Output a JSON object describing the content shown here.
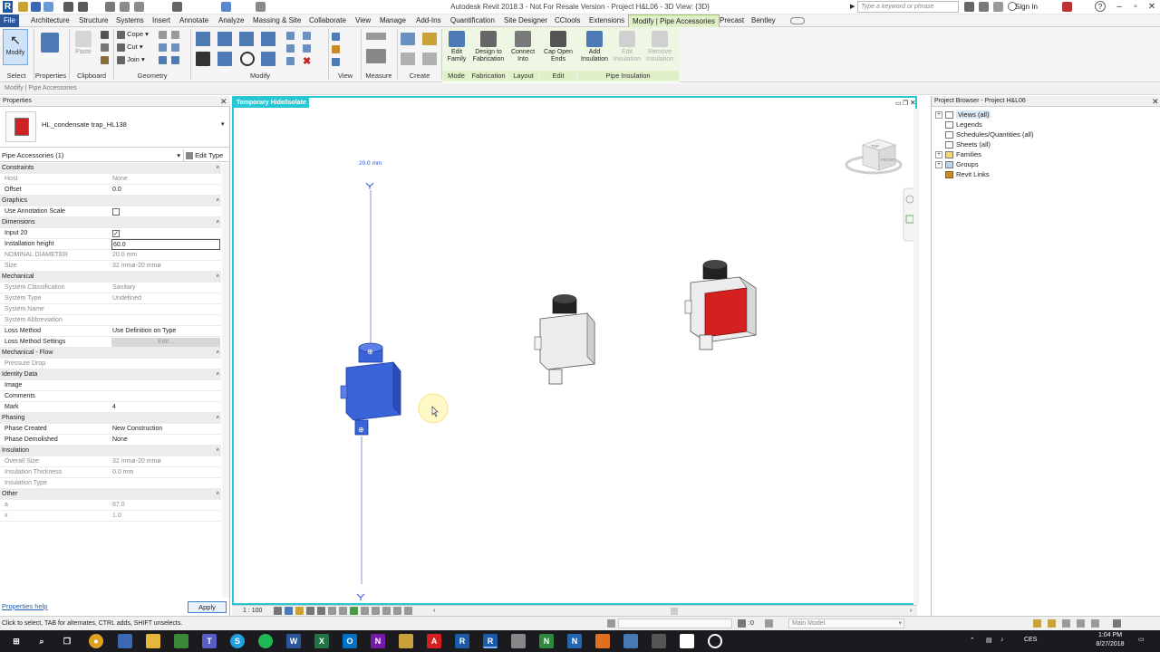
{
  "app": {
    "title": "Autodesk Revit 2018.3 - Not For Resale Version -   Project H&L06 - 3D View: {3D}",
    "search_placeholder": "Type a keyword or phrase",
    "sign_in": "Sign In",
    "help": "?"
  },
  "ribbon_tabs": [
    "File",
    "Architecture",
    "Structure",
    "Systems",
    "Insert",
    "Annotate",
    "Analyze",
    "Massing & Site",
    "Collaborate",
    "View",
    "Manage",
    "Add-Ins",
    "Quantification",
    "Site Designer",
    "CCtools",
    "Extensions",
    "Modify | Pipe Accessories",
    "Precast",
    "Bentley"
  ],
  "ribbon": {
    "modify": "Modify",
    "paste": "Paste",
    "cope": "Cope",
    "cut": "Cut",
    "join": "Join",
    "edit_family": "Edit Family",
    "design_fabrication": "Design to Fabrication",
    "connect_into": "Connect Into",
    "cap_open_ends": "Cap Open Ends",
    "add_insulation": "Add Insulation",
    "edit_insulation": "Edit Insulation",
    "remove_insulation": "Remove Insulation",
    "panels": {
      "select": "Select",
      "properties": "Properties",
      "clipboard": "Clipboard",
      "geometry": "Geometry",
      "modify": "Modify",
      "view": "View",
      "measure": "Measure",
      "create": "Create",
      "mode": "Mode",
      "fabrication": "Fabrication",
      "layout": "Layout",
      "edit": "Edit",
      "pipe_insulation": "Pipe Insulation"
    }
  },
  "context_line": "Modify | Pipe Accessories",
  "properties": {
    "header": "Properties",
    "type_name": "HL_condensate trap_HL138",
    "instance_selector": "Pipe Accessories (1)",
    "edit_type": "Edit Type",
    "help_link": "Properties help",
    "apply": "Apply",
    "rows": [
      {
        "k": "Constraints",
        "kind": "group"
      },
      {
        "k": "Host",
        "v": "None",
        "kind": "ro"
      },
      {
        "k": "Offset",
        "v": "0.0",
        "kind": "rw"
      },
      {
        "k": "Graphics",
        "kind": "group"
      },
      {
        "k": "Use Annotation Scale",
        "v": "",
        "kind": "check"
      },
      {
        "k": "Dimensions",
        "kind": "group"
      },
      {
        "k": "Input 20",
        "v": "✓",
        "kind": "check"
      },
      {
        "k": "Installation height",
        "v": "60.0",
        "kind": "edit"
      },
      {
        "k": "NOMINAL DIAMETER",
        "v": "20.0 mm",
        "kind": "ro"
      },
      {
        "k": "Size",
        "v": "32 mmø-20 mmø",
        "kind": "ro"
      },
      {
        "k": "Mechanical",
        "kind": "group"
      },
      {
        "k": "System Classification",
        "v": "Sanitary",
        "kind": "ro"
      },
      {
        "k": "System Type",
        "v": "Undefined",
        "kind": "ro"
      },
      {
        "k": "System Name",
        "v": "",
        "kind": "ro"
      },
      {
        "k": "System Abbreviation",
        "v": "",
        "kind": "ro"
      },
      {
        "k": "Loss Method",
        "v": "Use Definition on Type",
        "kind": "rw"
      },
      {
        "k": "Loss Method Settings",
        "v": "Edit...",
        "kind": "button"
      },
      {
        "k": "Mechanical - Flow",
        "kind": "group"
      },
      {
        "k": "Pressure Drop",
        "v": "",
        "kind": "ro"
      },
      {
        "k": "Identity Data",
        "kind": "group"
      },
      {
        "k": "Image",
        "v": "",
        "kind": "rw"
      },
      {
        "k": "Comments",
        "v": "",
        "kind": "rw"
      },
      {
        "k": "Mark",
        "v": "4",
        "kind": "rw"
      },
      {
        "k": "Phasing",
        "kind": "group"
      },
      {
        "k": "Phase Created",
        "v": "New Construction",
        "kind": "rw"
      },
      {
        "k": "Phase Demolished",
        "v": "None",
        "kind": "rw"
      },
      {
        "k": "Insulation",
        "kind": "group"
      },
      {
        "k": "Overall Size",
        "v": "32 mmø-20 mmø",
        "kind": "ro"
      },
      {
        "k": "Insulation Thickness",
        "v": "0.0 mm",
        "kind": "ro"
      },
      {
        "k": "Insulation Type",
        "v": "",
        "kind": "ro"
      },
      {
        "k": "Other",
        "kind": "group"
      },
      {
        "k": "a",
        "v": "87.0",
        "kind": "ro"
      },
      {
        "k": "x",
        "v": "1.0",
        "kind": "ro"
      }
    ]
  },
  "viewport": {
    "label": "Temporary Hide/Isolate",
    "dimension_text": "20.0 mm",
    "viewcube_top": "TOP",
    "viewcube_front": "FRONT",
    "scale": "1 : 100"
  },
  "browser": {
    "header": "Project Browser - Project H&L06",
    "items": [
      "Views (all)",
      "Legends",
      "Schedules/Quantities (all)",
      "Sheets (all)",
      "Families",
      "Groups",
      "Revit Links"
    ]
  },
  "statusbar": {
    "message": "Click to select, TAB for alternates, CTRL adds, SHIFT unselects.",
    "count": ":0",
    "model": "Main Model"
  },
  "taskbar": {
    "lang": "CES",
    "time": "1:04 PM",
    "date": "8/27/2018"
  },
  "colors": {
    "accent": "#27c7d6",
    "selected_part": "#3b63d9",
    "context_tab": "#dff0c8"
  }
}
